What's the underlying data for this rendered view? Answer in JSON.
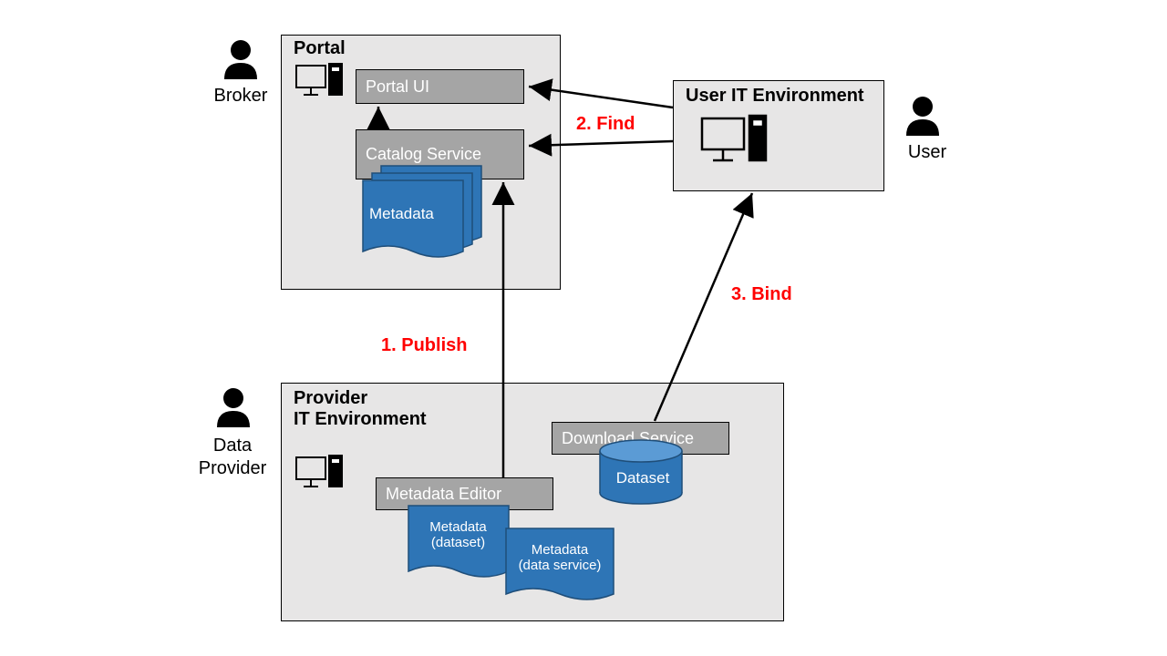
{
  "actors": {
    "broker": "Broker",
    "user": "User",
    "dataProvider": "Data\nProvider"
  },
  "containers": {
    "portal": {
      "title": "Portal",
      "components": {
        "portalUI": "Portal UI",
        "catalogService": "Catalog Service",
        "metadataDoc": "Metadata"
      }
    },
    "userEnv": {
      "title": "User IT Environment"
    },
    "providerEnv": {
      "title": "Provider\nIT Environment",
      "components": {
        "downloadService": "Download Service",
        "metadataEditor": "Metadata Editor",
        "dataset": "Dataset",
        "metaDataset": "Metadata\n(dataset)",
        "metaDataService": "Metadata\n(data service)"
      }
    }
  },
  "flows": {
    "publish": "1. Publish",
    "find": "2. Find",
    "bind": "3. Bind"
  },
  "colors": {
    "containerBg": "#e7e6e6",
    "greyBox": "#a5a5a5",
    "blueFill": "#2e75b6",
    "blueStroke": "#1f4e79",
    "red": "#ff0000"
  }
}
